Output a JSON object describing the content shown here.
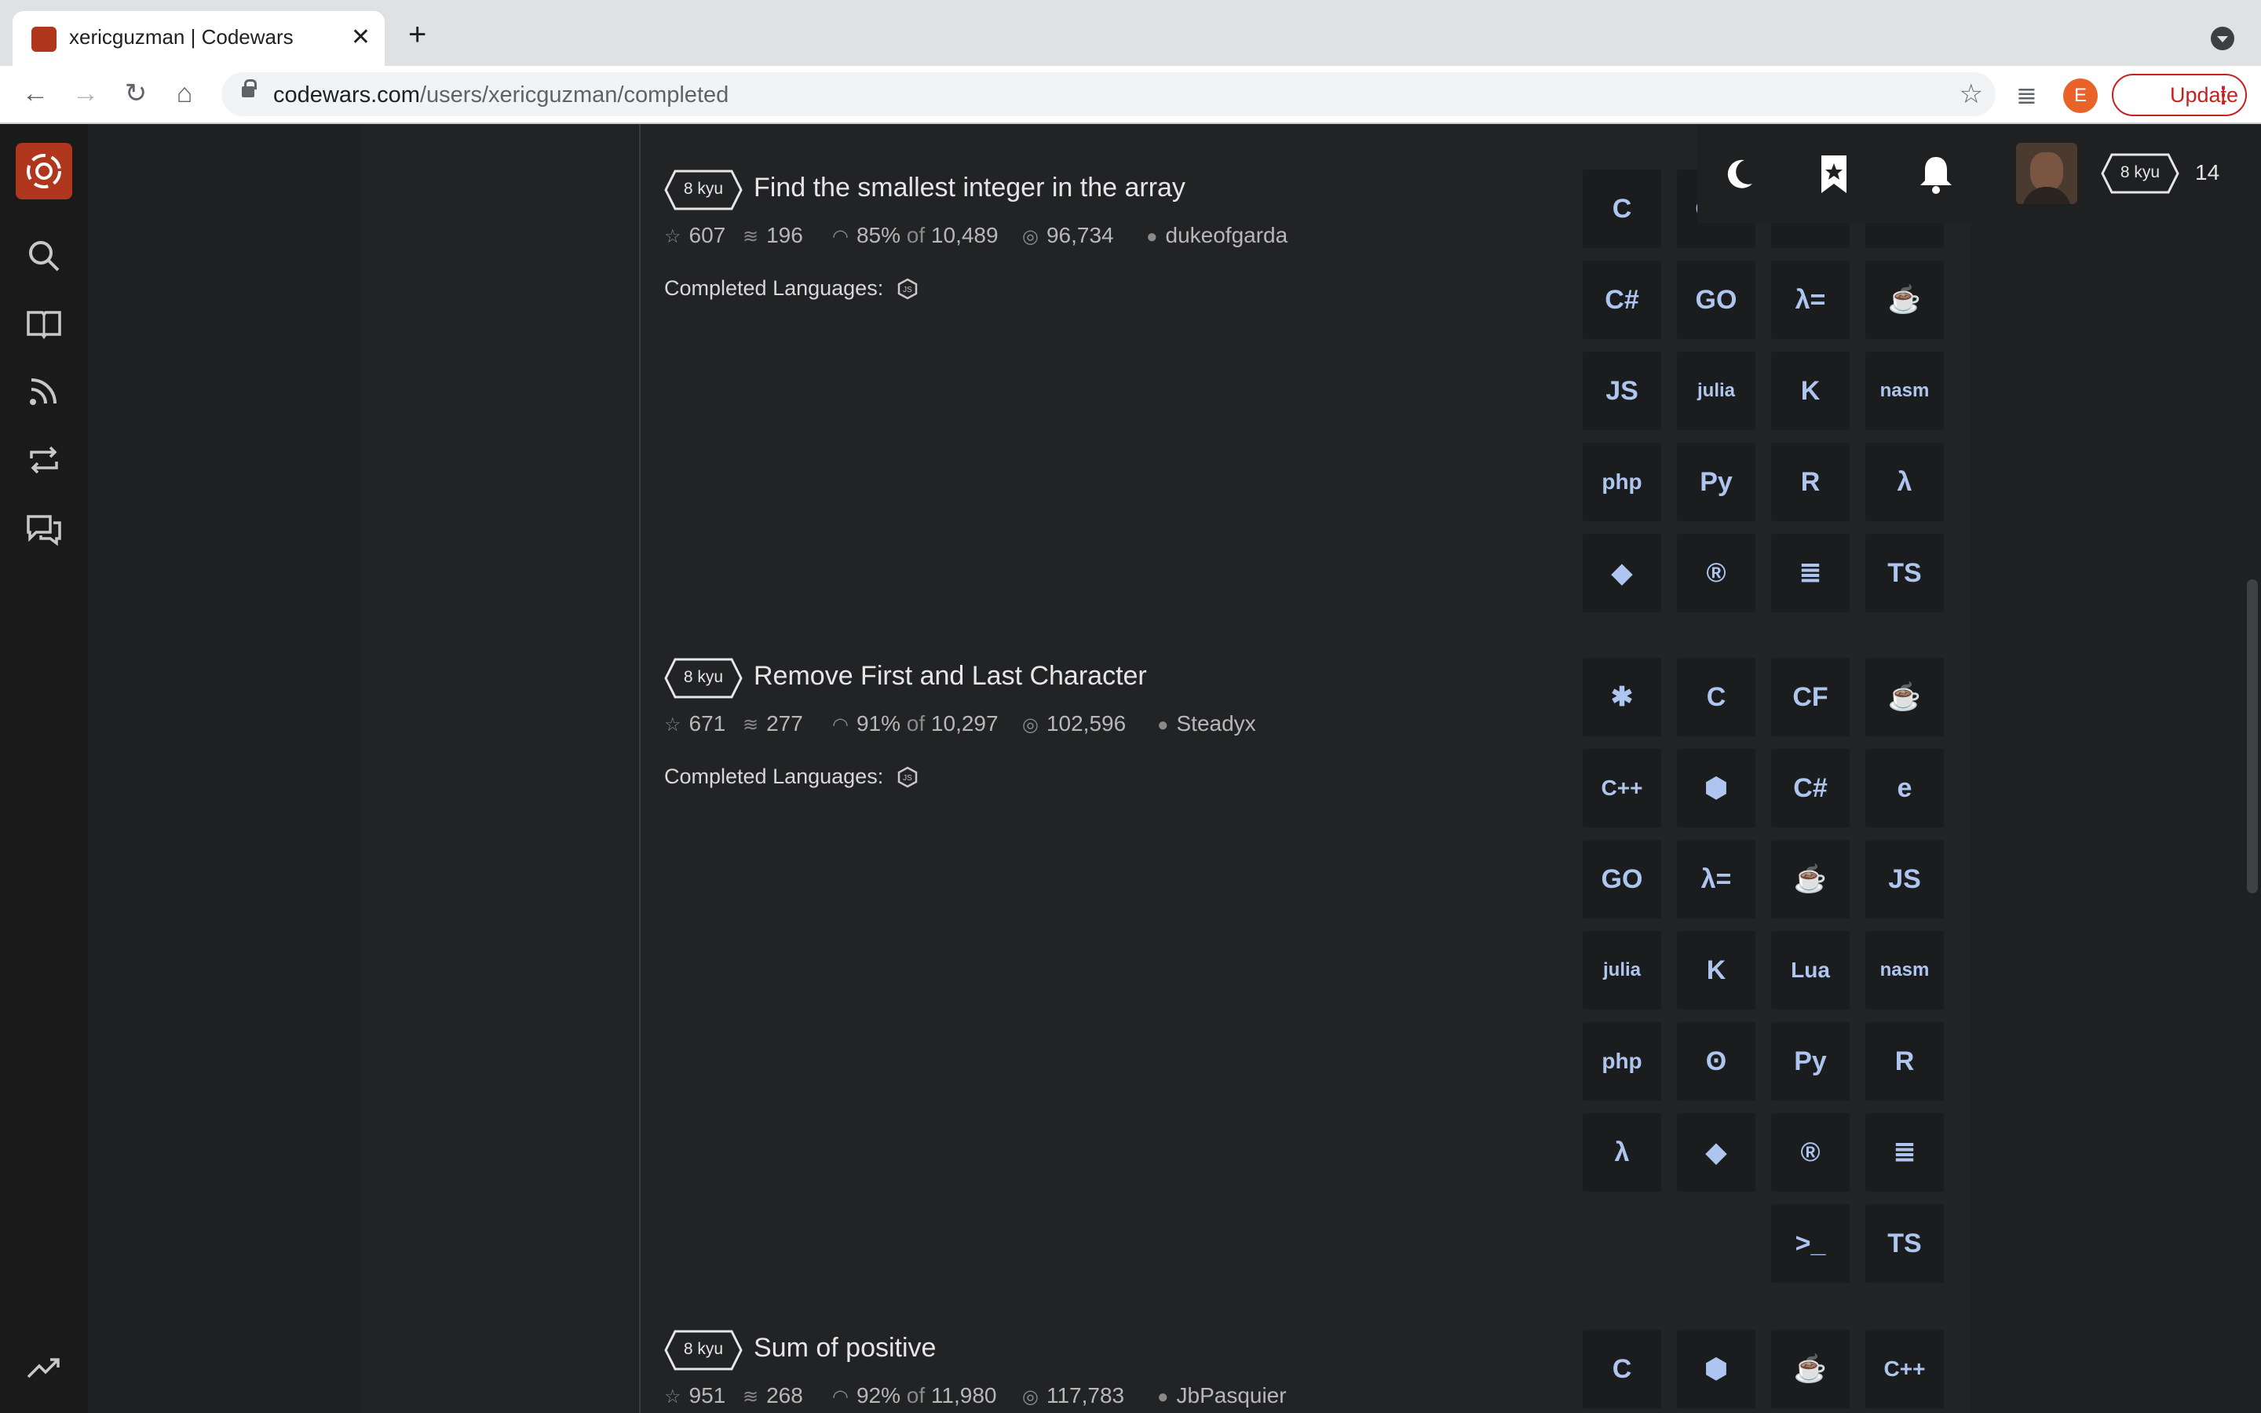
{
  "browser": {
    "tab_title": "xericguzman | Codewars",
    "url_domain": "codewars.com",
    "url_path": "/users/xericguzman/completed",
    "update_label": "Update",
    "profile_initial": "E"
  },
  "header": {
    "rank": "8 kyu",
    "honor": "14"
  },
  "katas": [
    {
      "rank": "8 kyu",
      "title": "Find the smallest integer in the array",
      "stars": "607",
      "collections": "196",
      "satisfaction": "85%",
      "of_label": "of",
      "votes": "10,489",
      "completions": "96,734",
      "author": "dukeofgarda",
      "completed_label": "Completed Languages:",
      "languages": [
        "C",
        "C++",
        "Clojure",
        "CoffeeScript",
        "C#",
        "Go",
        "Haskell",
        "Java",
        "JavaScript",
        "Julia",
        "Kotlin",
        "NASM",
        "PHP",
        "Python",
        "R",
        "Racket",
        "Ruby",
        "Rust",
        "Scala",
        "TypeScript"
      ]
    },
    {
      "rank": "8 kyu",
      "title": "Remove First and Last Character",
      "stars": "671",
      "collections": "277",
      "satisfaction": "91%",
      "of_label": "of",
      "votes": "10,297",
      "completions": "102,596",
      "author": "Steadyx",
      "completed_label": "Completed Languages:",
      "languages": [
        "BF",
        "C",
        "CFML",
        "CoffeeScript",
        "C++",
        "Crystal",
        "C#",
        "Elixir",
        "Go",
        "Haskell",
        "Java",
        "JavaScript",
        "Julia",
        "Kotlin",
        "Lua",
        "NASM",
        "PHP",
        "Prolog",
        "Python",
        "R",
        "Racket",
        "Ruby",
        "Rust",
        "Scala",
        "Shell",
        "TypeScript"
      ]
    },
    {
      "rank": "8 kyu",
      "title": "Sum of positive",
      "stars": "951",
      "collections": "268",
      "satisfaction": "92%",
      "of_label": "of",
      "votes": "11,980",
      "completions": "117,783",
      "author": "JbPasquier",
      "languages": [
        "C",
        "Crystal",
        "CoffeeScript",
        "C++"
      ]
    }
  ],
  "colors": {
    "brand": "#b1361e",
    "lang_icon": "#aec6ef",
    "background": "#222324"
  }
}
